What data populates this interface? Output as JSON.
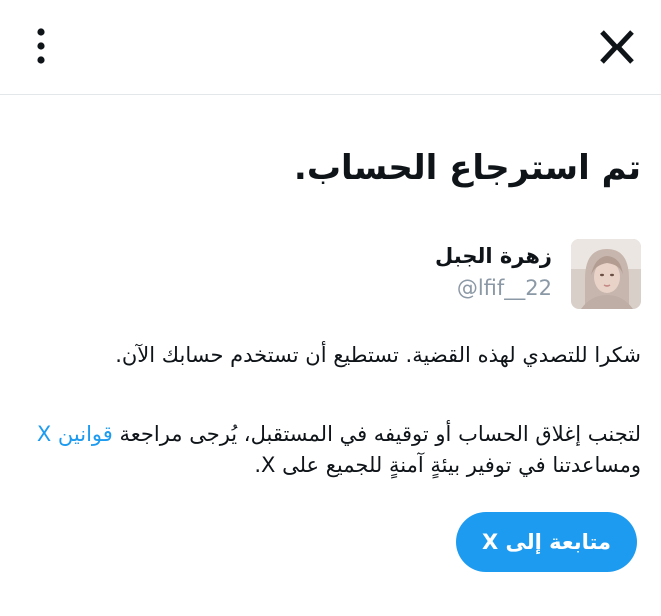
{
  "header": {
    "menu_icon": "more-vertical-icon",
    "logo_icon": "x-logo-icon"
  },
  "main": {
    "title": "تم استرجاع الحساب.",
    "profile": {
      "name": "زهرة الجبل",
      "handle": "@lfif__22"
    },
    "message_line1": "شكرا للتصدي لهذه القضية. تستطيع أن تستخدم حسابك الآن.",
    "message_line2_prefix": "لتجنب إغلاق الحساب أو توقيفه في المستقبل، يُرجى مراجعة ",
    "rules_link": "قوانين X",
    "message_line2_suffix": " ومساعدتنا في توفير بيئةٍ آمنةٍ للجميع على X.",
    "continue_button": "متابعة إلى X"
  },
  "colors": {
    "accent": "#1d9bf0",
    "text": "#0f1419",
    "muted": "#8b98a5"
  }
}
